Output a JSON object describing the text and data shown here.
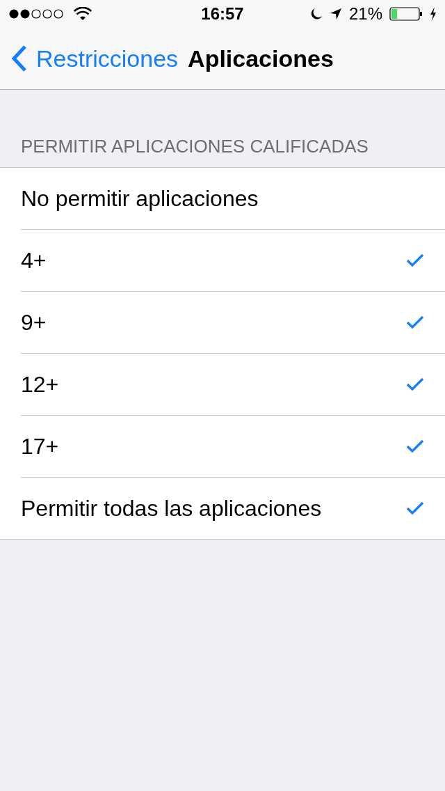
{
  "status_bar": {
    "time": "16:57",
    "battery": "21%"
  },
  "nav": {
    "back": "Restricciones",
    "title": "Aplicaciones"
  },
  "section": {
    "header": "PERMITIR APLICACIONES CALIFICADAS",
    "items": [
      {
        "label": "No permitir aplicaciones",
        "checked": false
      },
      {
        "label": "4+",
        "checked": true
      },
      {
        "label": "9+",
        "checked": true
      },
      {
        "label": "12+",
        "checked": true
      },
      {
        "label": "17+",
        "checked": true
      },
      {
        "label": "Permitir todas las aplicaciones",
        "checked": true
      }
    ]
  }
}
